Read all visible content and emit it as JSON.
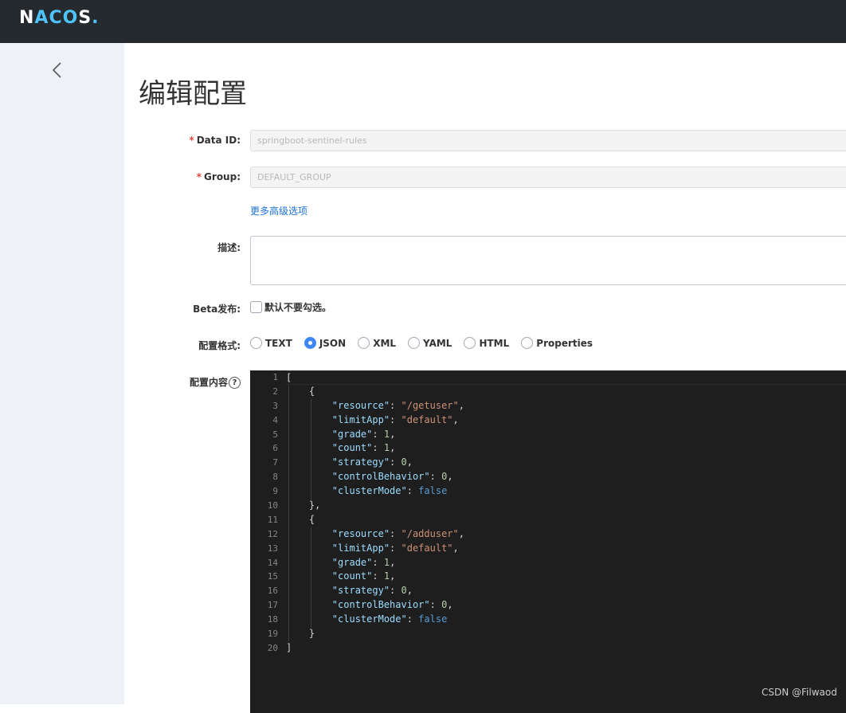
{
  "app": {
    "logo": "NACOS."
  },
  "page": {
    "title": "编辑配置"
  },
  "form": {
    "data_id_label": "Data ID:",
    "data_id_value": "springboot-sentinel-rules",
    "group_label": "Group:",
    "group_value": "DEFAULT_GROUP",
    "advanced_link": "更多高级选项",
    "desc_label": "描述:",
    "beta_label": "Beta发布:",
    "beta_checkbox_text": "默认不要勾选。",
    "format_label": "配置格式:",
    "formats": [
      "TEXT",
      "JSON",
      "XML",
      "YAML",
      "HTML",
      "Properties"
    ],
    "selected_format": "JSON",
    "content_label": "配置内容",
    "help_glyph": "?"
  },
  "editor": {
    "line_numbers": [
      "1",
      "2",
      "3",
      "4",
      "5",
      "6",
      "7",
      "8",
      "9",
      "10",
      "11",
      "12",
      "13",
      "14",
      "15",
      "16",
      "17",
      "18",
      "19",
      "20"
    ],
    "rules": [
      {
        "resource": "\"/getuser\"",
        "limitApp": "\"default\"",
        "grade": "1",
        "count": "1",
        "strategy": "0",
        "controlBehavior": "0",
        "clusterMode": "false"
      },
      {
        "resource": "\"/adduser\"",
        "limitApp": "\"default\"",
        "grade": "1",
        "count": "1",
        "strategy": "0",
        "controlBehavior": "0",
        "clusterMode": "false"
      }
    ],
    "keys": {
      "resource": "\"resource\"",
      "limitApp": "\"limitApp\"",
      "grade": "\"grade\"",
      "count": "\"count\"",
      "strategy": "\"strategy\"",
      "controlBehavior": "\"controlBehavior\"",
      "clusterMode": "\"clusterMode\""
    }
  },
  "watermark": "CSDN @Filwaod"
}
